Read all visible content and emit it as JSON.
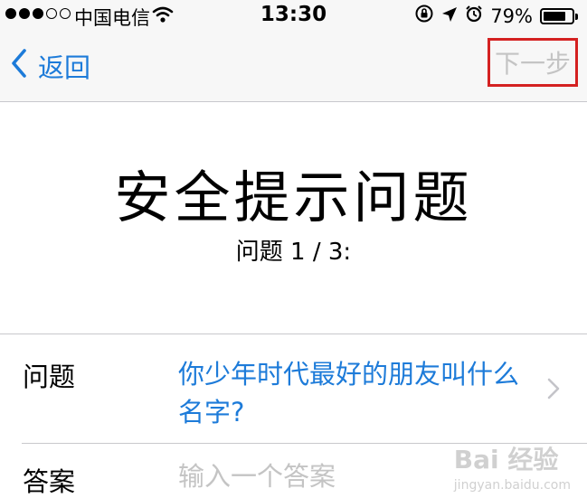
{
  "status_bar": {
    "carrier": "中国电信",
    "time": "13:30",
    "battery_percent": "79%",
    "battery_level": 0.79,
    "signal_bars_filled": 3,
    "signal_bars_total": 5,
    "icons": [
      "signal-icon",
      "wifi-icon",
      "rotation-lock-icon",
      "location-arrow-icon",
      "alarm-icon",
      "battery-icon"
    ]
  },
  "nav": {
    "back_label": "返回",
    "next_label": "下一步",
    "highlight_color": "#d42121",
    "link_color": "#1d7bd9"
  },
  "header": {
    "title": "安全提示问题",
    "subtitle": "问题 1 / 3:"
  },
  "form": {
    "question_label": "问题",
    "question_value": "你少年时代最好的朋友叫什么名字?",
    "answer_label": "答案",
    "answer_placeholder": "输入一个答案",
    "answer_value": ""
  },
  "watermark": {
    "brand": "Bai 经验",
    "url": "jingyan.baidu.com"
  }
}
